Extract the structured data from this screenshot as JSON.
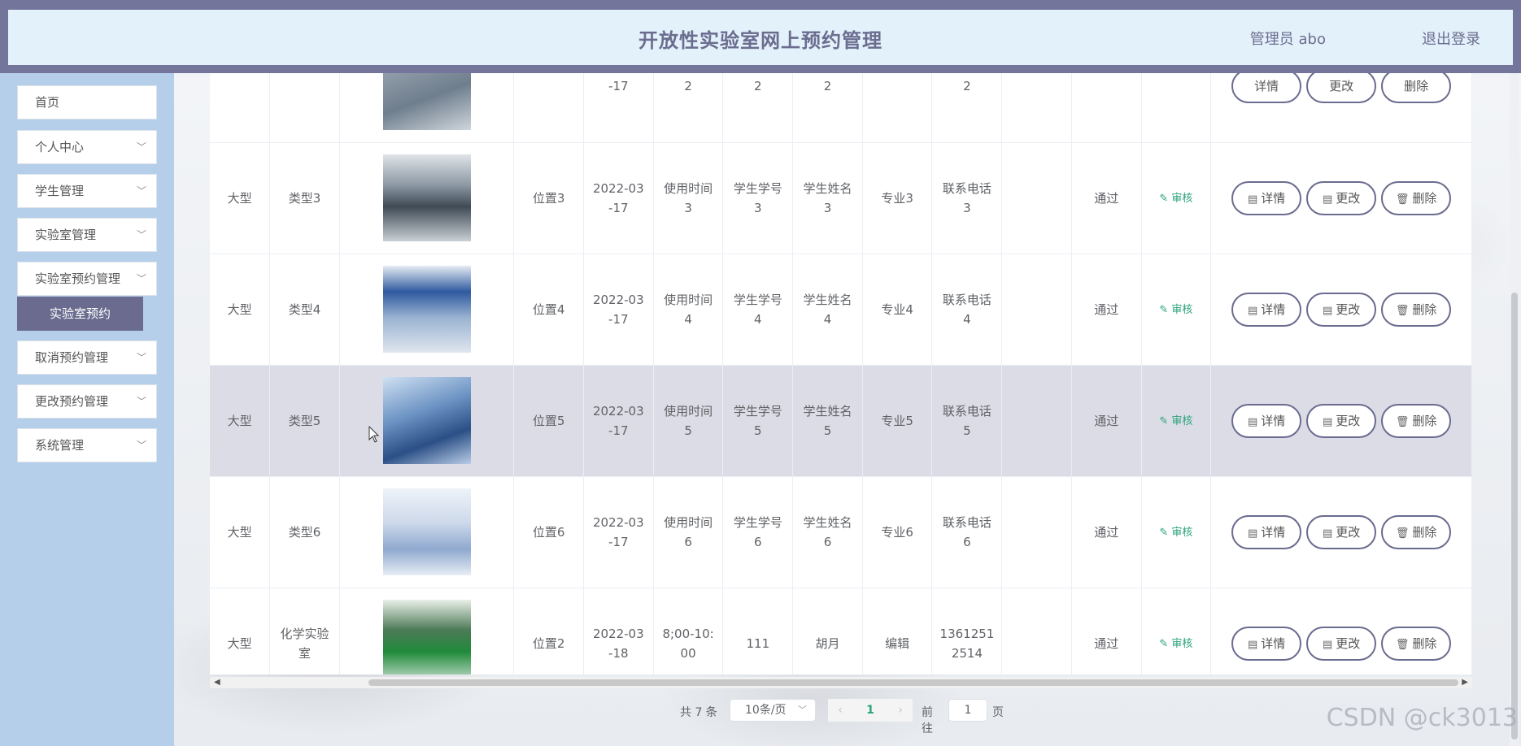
{
  "header": {
    "title": "开放性实验室网上预约管理",
    "user": "管理员 abo",
    "logout": "退出登录"
  },
  "sidebar": {
    "items": [
      {
        "label": "首页",
        "expandable": false
      },
      {
        "label": "个人中心",
        "expandable": true
      },
      {
        "label": "学生管理",
        "expandable": true
      },
      {
        "label": "实验室管理",
        "expandable": true
      },
      {
        "label": "实验室预约管理",
        "expandable": true
      },
      {
        "label": "取消预约管理",
        "expandable": true
      },
      {
        "label": "更改预约管理",
        "expandable": true
      },
      {
        "label": "系统管理",
        "expandable": true
      }
    ],
    "active_sub": "实验室预约"
  },
  "table": {
    "partial_row": {
      "date": "-17",
      "c1": "2",
      "c2": "2",
      "c3": "2",
      "c5": "2"
    },
    "rows": [
      {
        "size": "大型",
        "type": "类型3",
        "location": "位置3",
        "date": "2022-03\n-17",
        "time": "使用时间\n3",
        "student_no": "学生学号\n3",
        "student_name": "学生姓名\n3",
        "major": "专业3",
        "phone": "联系电话\n3",
        "status": "通过",
        "audit": "审核"
      },
      {
        "size": "大型",
        "type": "类型4",
        "location": "位置4",
        "date": "2022-03\n-17",
        "time": "使用时间\n4",
        "student_no": "学生学号\n4",
        "student_name": "学生姓名\n4",
        "major": "专业4",
        "phone": "联系电话\n4",
        "status": "通过",
        "audit": "审核"
      },
      {
        "size": "大型",
        "type": "类型5",
        "location": "位置5",
        "date": "2022-03\n-17",
        "time": "使用时间\n5",
        "student_no": "学生学号\n5",
        "student_name": "学生姓名\n5",
        "major": "专业5",
        "phone": "联系电话\n5",
        "status": "通过",
        "audit": "审核"
      },
      {
        "size": "大型",
        "type": "类型6",
        "location": "位置6",
        "date": "2022-03\n-17",
        "time": "使用时间\n6",
        "student_no": "学生学号\n6",
        "student_name": "学生姓名\n6",
        "major": "专业6",
        "phone": "联系电话\n6",
        "status": "通过",
        "audit": "审核"
      },
      {
        "size": "大型",
        "type": "化学实验\n室",
        "location": "位置2",
        "date": "2022-03\n-18",
        "time": "8;00-10:\n00",
        "student_no": "111",
        "student_name": "胡月",
        "major": "编辑",
        "phone": "1361251\n2514",
        "status": "通过",
        "audit": "审核"
      }
    ],
    "actions": {
      "detail": "详情",
      "edit": "更改",
      "delete": "删除"
    }
  },
  "pagination": {
    "total": "共 7 条",
    "page_size": "10条/页",
    "current": "1",
    "goto_label": "前往",
    "goto_value": "1",
    "page_label": "页"
  },
  "watermark": "CSDN @ck3013",
  "colors": {
    "accent": "#6a6b8f",
    "audit": "#2aa37c",
    "sidebar": "#b5cfeb"
  }
}
